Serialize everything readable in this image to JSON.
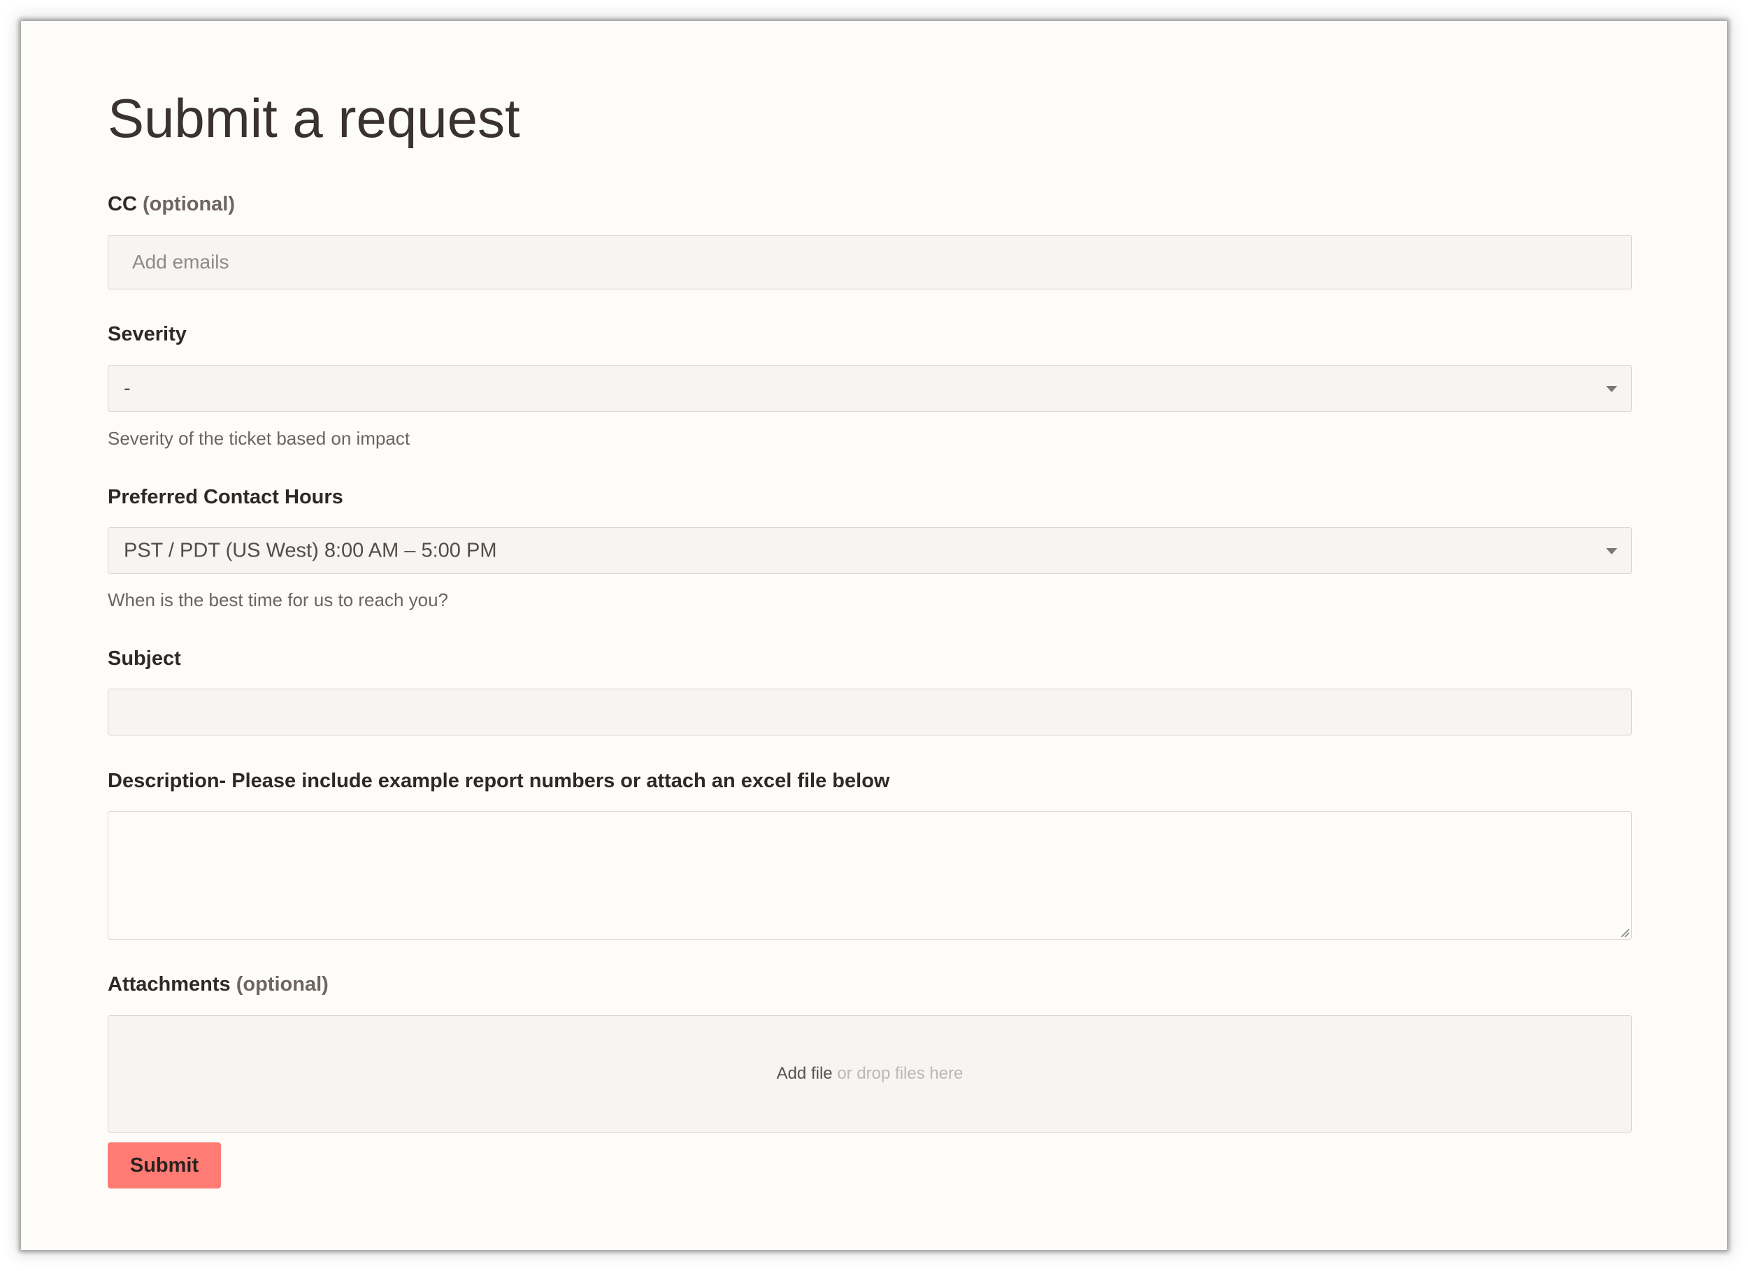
{
  "page": {
    "title": "Submit a request"
  },
  "cc": {
    "label": "CC",
    "optional": "(optional)",
    "placeholder": "Add emails"
  },
  "severity": {
    "label": "Severity",
    "selected": "-",
    "hint": "Severity of the ticket based on impact"
  },
  "contact_hours": {
    "label": "Preferred Contact Hours",
    "selected": "PST / PDT (US West) 8:00 AM – 5:00 PM",
    "hint": "When is the best time for us to reach you?"
  },
  "subject": {
    "label": "Subject",
    "value": ""
  },
  "description": {
    "label": "Description- Please include example report numbers or attach an excel file below",
    "value": ""
  },
  "attachments": {
    "label": "Attachments",
    "optional": "(optional)",
    "add_file": "Add file",
    "drop_hint": "or drop files here"
  },
  "submit": {
    "label": "Submit"
  },
  "colors": {
    "background": "#fdfcf9",
    "field_background": "#f6f5f2",
    "field_border": "#d9d6d1",
    "submit_button": "#ff7b74",
    "text": "#2f2826"
  }
}
